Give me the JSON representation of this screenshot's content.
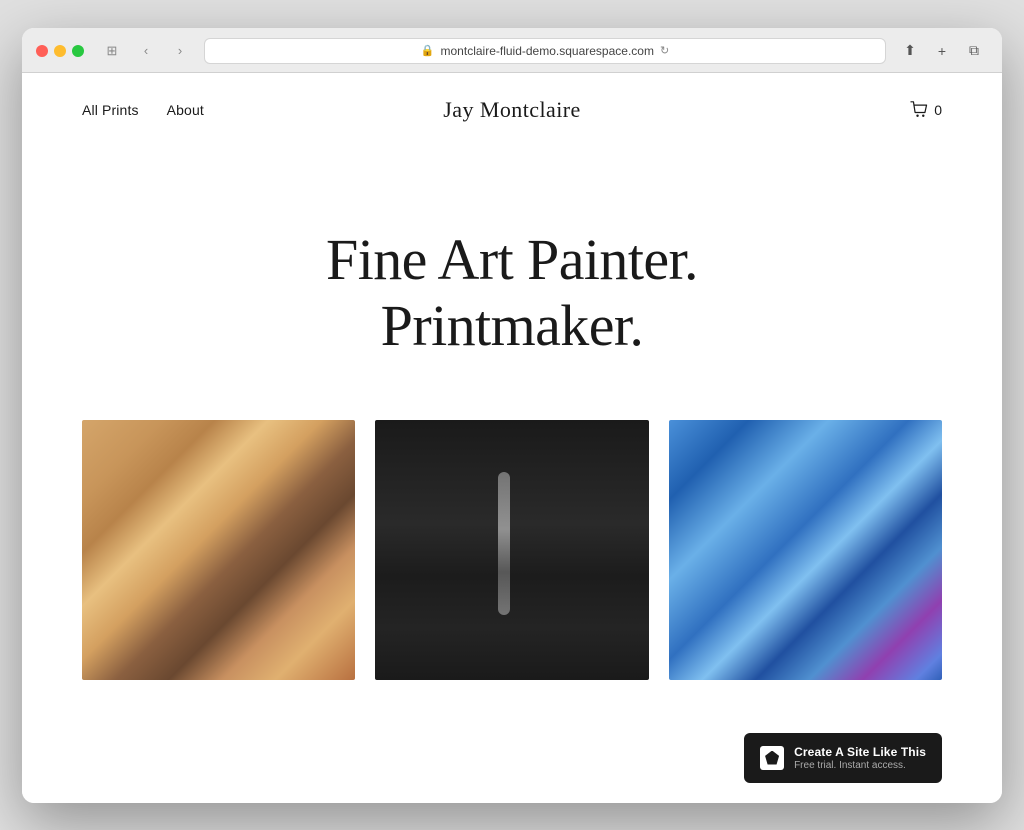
{
  "browser": {
    "url": "montclaire-fluid-demo.squarespace.com",
    "back_btn": "‹",
    "forward_btn": "›",
    "window_btn": "⊞",
    "reload_icon": "↻",
    "share_icon": "⬆",
    "new_tab_icon": "+",
    "duplicate_icon": "⧉"
  },
  "nav": {
    "left_links": [
      {
        "label": "All Prints",
        "id": "all-prints"
      },
      {
        "label": "About",
        "id": "about"
      }
    ],
    "site_title": "Jay Montclaire",
    "cart_count": "0"
  },
  "hero": {
    "line1": "Fine Art Painter.",
    "line2": "Printmaker."
  },
  "gallery": {
    "items": [
      {
        "id": "warm-abstract",
        "alt": "Warm abstract painting",
        "style_class": "img-warm"
      },
      {
        "id": "dark-abstract",
        "alt": "Dark abstract painting",
        "style_class": "img-dark"
      },
      {
        "id": "blue-abstract",
        "alt": "Blue abstract painting",
        "style_class": "img-blue"
      }
    ]
  },
  "squarespace_banner": {
    "main_text": "Create A Site Like This",
    "sub_text": "Free trial. Instant access."
  }
}
